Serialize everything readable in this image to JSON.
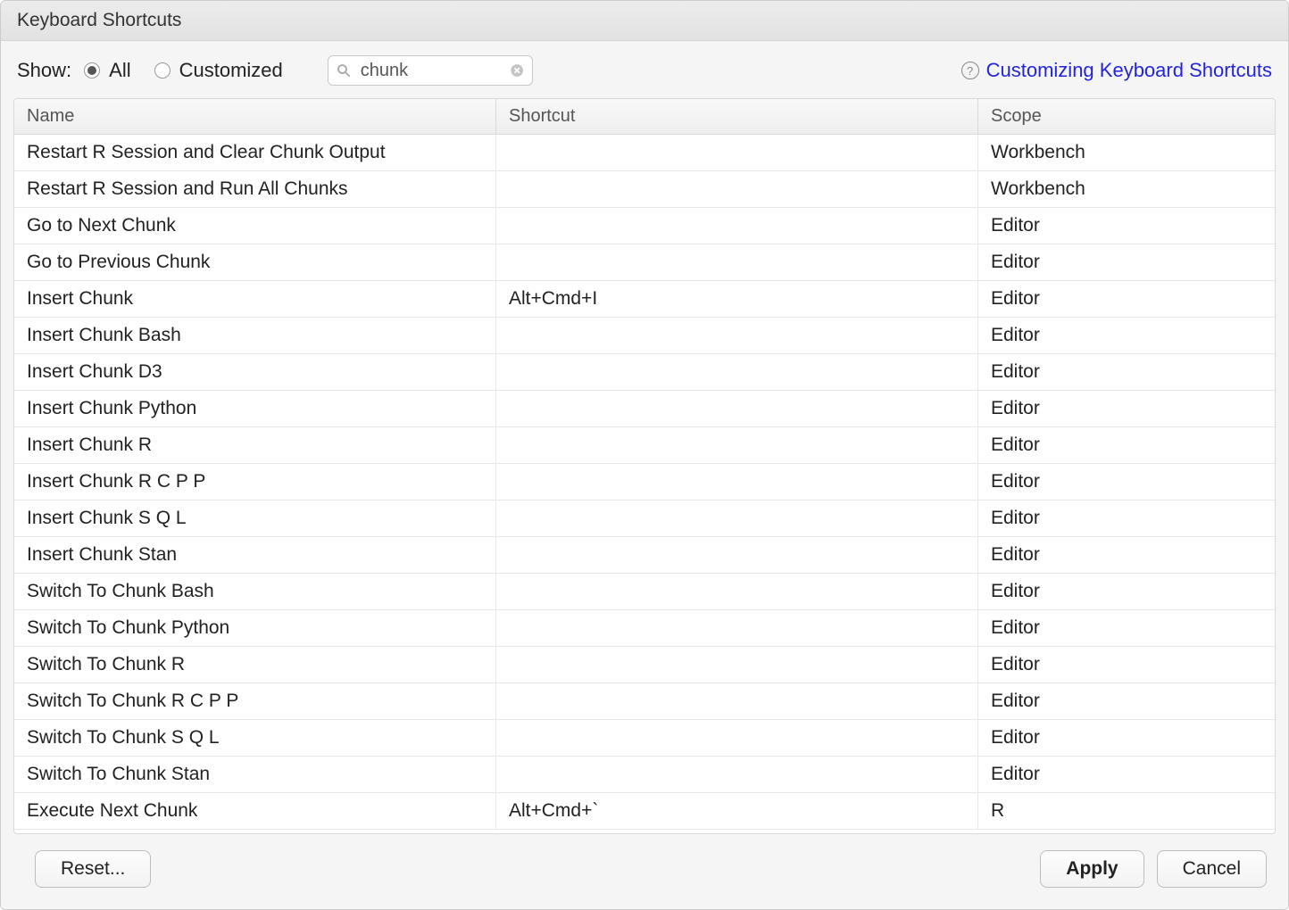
{
  "title": "Keyboard Shortcuts",
  "toolbar": {
    "show_label": "Show:",
    "radio_all": "All",
    "radio_customized": "Customized",
    "search_value": "chunk"
  },
  "help_link": "Customizing Keyboard Shortcuts",
  "columns": {
    "name": "Name",
    "shortcut": "Shortcut",
    "scope": "Scope"
  },
  "rows": [
    {
      "name": "Restart R Session and Clear Chunk Output",
      "shortcut": "",
      "scope": "Workbench"
    },
    {
      "name": "Restart R Session and Run All Chunks",
      "shortcut": "",
      "scope": "Workbench"
    },
    {
      "name": "Go to Next Chunk",
      "shortcut": "",
      "scope": "Editor"
    },
    {
      "name": "Go to Previous Chunk",
      "shortcut": "",
      "scope": "Editor"
    },
    {
      "name": "Insert Chunk",
      "shortcut": "Alt+Cmd+I",
      "scope": "Editor"
    },
    {
      "name": "Insert Chunk Bash",
      "shortcut": "",
      "scope": "Editor"
    },
    {
      "name": "Insert Chunk D3",
      "shortcut": "",
      "scope": "Editor"
    },
    {
      "name": "Insert Chunk Python",
      "shortcut": "",
      "scope": "Editor"
    },
    {
      "name": "Insert Chunk R",
      "shortcut": "",
      "scope": "Editor"
    },
    {
      "name": "Insert Chunk R C P P",
      "shortcut": "",
      "scope": "Editor"
    },
    {
      "name": "Insert Chunk S Q L",
      "shortcut": "",
      "scope": "Editor"
    },
    {
      "name": "Insert Chunk Stan",
      "shortcut": "",
      "scope": "Editor"
    },
    {
      "name": "Switch To Chunk Bash",
      "shortcut": "",
      "scope": "Editor"
    },
    {
      "name": "Switch To Chunk Python",
      "shortcut": "",
      "scope": "Editor"
    },
    {
      "name": "Switch To Chunk R",
      "shortcut": "",
      "scope": "Editor"
    },
    {
      "name": "Switch To Chunk R C P P",
      "shortcut": "",
      "scope": "Editor"
    },
    {
      "name": "Switch To Chunk S Q L",
      "shortcut": "",
      "scope": "Editor"
    },
    {
      "name": "Switch To Chunk Stan",
      "shortcut": "",
      "scope": "Editor"
    },
    {
      "name": "Execute Next Chunk",
      "shortcut": "Alt+Cmd+`",
      "scope": "R"
    }
  ],
  "buttons": {
    "reset": "Reset...",
    "apply": "Apply",
    "cancel": "Cancel"
  }
}
